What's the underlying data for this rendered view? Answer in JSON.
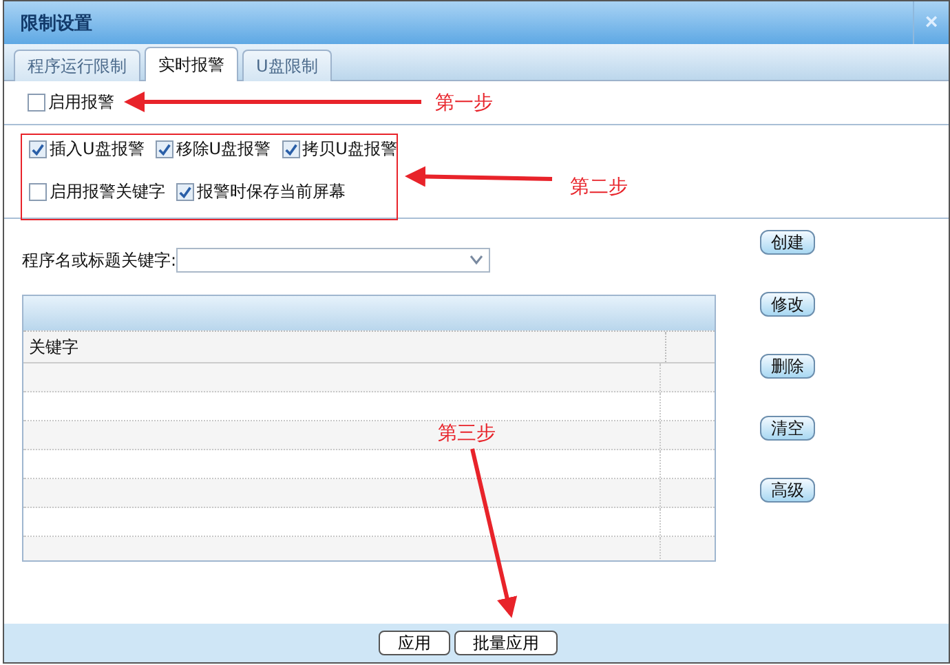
{
  "window": {
    "title": "限制设置",
    "close": "×"
  },
  "tabs": [
    {
      "label": "程序运行限制",
      "selected": false
    },
    {
      "label": "实时报警",
      "selected": true
    },
    {
      "label": "U盘限制",
      "selected": false
    }
  ],
  "enable_alarm": {
    "label": "启用报警",
    "checked": false
  },
  "alarm_options": [
    [
      {
        "label": "插入U盘报警",
        "checked": true
      },
      {
        "label": "移除U盘报警",
        "checked": true
      },
      {
        "label": "拷贝U盘报警",
        "checked": true
      }
    ],
    [
      {
        "label": "启用报警关键字",
        "checked": false
      },
      {
        "label": "报警时保存当前屏幕",
        "checked": true
      }
    ]
  ],
  "keyword_filter": {
    "label": "程序名或标题关键字:"
  },
  "table": {
    "columns": [
      "关键字"
    ]
  },
  "side_buttons": [
    "创建",
    "修改",
    "删除",
    "清空",
    "高级"
  ],
  "footer_buttons": [
    "应用",
    "批量应用"
  ],
  "annotations": [
    "第一步",
    "第二步",
    "第三步"
  ]
}
